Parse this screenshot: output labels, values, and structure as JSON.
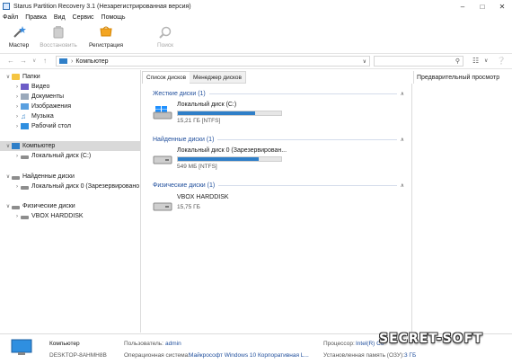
{
  "window": {
    "title": "Starus Partition Recovery 3.1 (Незарегистрированная версия)"
  },
  "menu": [
    "Файл",
    "Правка",
    "Вид",
    "Сервис",
    "Помощь"
  ],
  "ribbon": {
    "wizard": "Мастер",
    "restore": "Восстановить",
    "register": "Регистрация",
    "search": "Поиск"
  },
  "address": {
    "path": "Компьютер"
  },
  "tree": {
    "folders": "Папки",
    "video": "Видео",
    "documents": "Документы",
    "images": "Изображения",
    "music": "Музыка",
    "desktop": "Рабочий стол",
    "computer": "Компьютер",
    "local_c": "Локальный диск (C:)",
    "found_disks": "Найденные диски",
    "found_local0": "Локальный диск 0 (Зарезервировано",
    "physical_disks": "Физические диски",
    "vbox": "VBOX HARDDISK"
  },
  "tabs": {
    "disk_list": "Список дисков",
    "disk_manager": "Менеджер дисков"
  },
  "preview": {
    "label": "Предварительный просмотр"
  },
  "sections": {
    "hard": "Жесткие диски (1)",
    "found": "Найденные диски (1)",
    "physical": "Физические диски (1)"
  },
  "disks": {
    "c": {
      "name": "Локальный диск (C:)",
      "info": "15,21 ГБ [NTFS]",
      "fill_pct": 75
    },
    "found0": {
      "name": "Локальный диск 0 (Зарезервирован...",
      "info": "549 МБ [NTFS]",
      "fill_pct": 78
    },
    "vbox": {
      "name": "VBOX HARDDISK",
      "info": "15,75 ГБ"
    }
  },
  "status": {
    "computer": "Компьютер",
    "host": "DESKTOP-8AHMH8B",
    "user_label": "Пользователь:",
    "user": "admin",
    "os_label": "Операционная система:",
    "os": "Майкрософт Windows 10 Корпоративная L...",
    "cpu_label": "Процессор:",
    "cpu": "Intel(R) Co",
    "ram_label": "Установленная память (ОЗУ):",
    "ram": "3 ГБ"
  },
  "watermark": "SECRET-SOFT",
  "colors": {
    "accent": "#2f7fc8",
    "section_title": "#1f4e9c",
    "selection": "#d9d9d9"
  }
}
